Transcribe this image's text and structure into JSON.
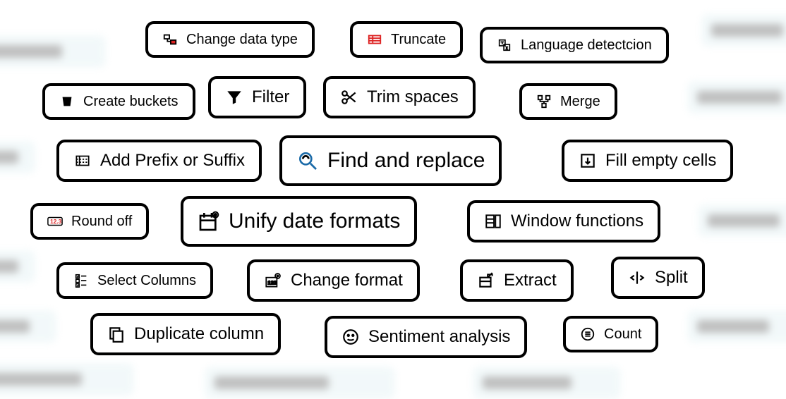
{
  "tiles": {
    "change_data_type": {
      "label": "Change data type"
    },
    "truncate": {
      "label": "Truncate"
    },
    "language_detection": {
      "label": "Language detectcion"
    },
    "create_buckets": {
      "label": "Create buckets"
    },
    "filter": {
      "label": "Filter"
    },
    "trim_spaces": {
      "label": "Trim spaces"
    },
    "merge": {
      "label": "Merge"
    },
    "add_prefix_suffix": {
      "label": "Add Prefix or Suffix"
    },
    "find_and_replace": {
      "label": "Find and replace"
    },
    "fill_empty_cells": {
      "label": "Fill empty cells"
    },
    "round_off": {
      "label": "Round off"
    },
    "unify_date_formats": {
      "label": "Unify date formats"
    },
    "window_functions": {
      "label": "Window functions"
    },
    "select_columns": {
      "label": "Select Columns"
    },
    "change_format": {
      "label": "Change format"
    },
    "extract": {
      "label": "Extract"
    },
    "split": {
      "label": "Split"
    },
    "duplicate_column": {
      "label": "Duplicate column"
    },
    "sentiment_analysis": {
      "label": "Sentiment analysis"
    },
    "count": {
      "label": "Count"
    }
  }
}
